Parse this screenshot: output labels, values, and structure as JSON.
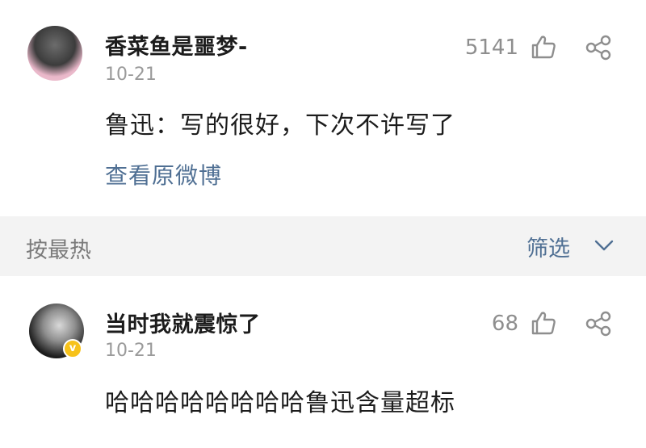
{
  "post": {
    "author": "香菜鱼是噩梦-",
    "date": "10-21",
    "likes": "5141",
    "content": "鲁迅：写的很好，下次不许写了",
    "view_original": "查看原微博"
  },
  "sort_bar": {
    "sort_label": "按最热",
    "filter_label": "筛选"
  },
  "comment": {
    "author": "当时我就震惊了",
    "date": "10-21",
    "likes": "68",
    "content": "哈哈哈哈哈哈哈哈鲁迅含量超标",
    "verified_badge": "v"
  },
  "colors": {
    "link": "#4f6f93",
    "text": "#1c1c1c",
    "muted": "#9a9a9a",
    "divider_bg": "#f3f3f3",
    "verified": "#f7c21a"
  }
}
